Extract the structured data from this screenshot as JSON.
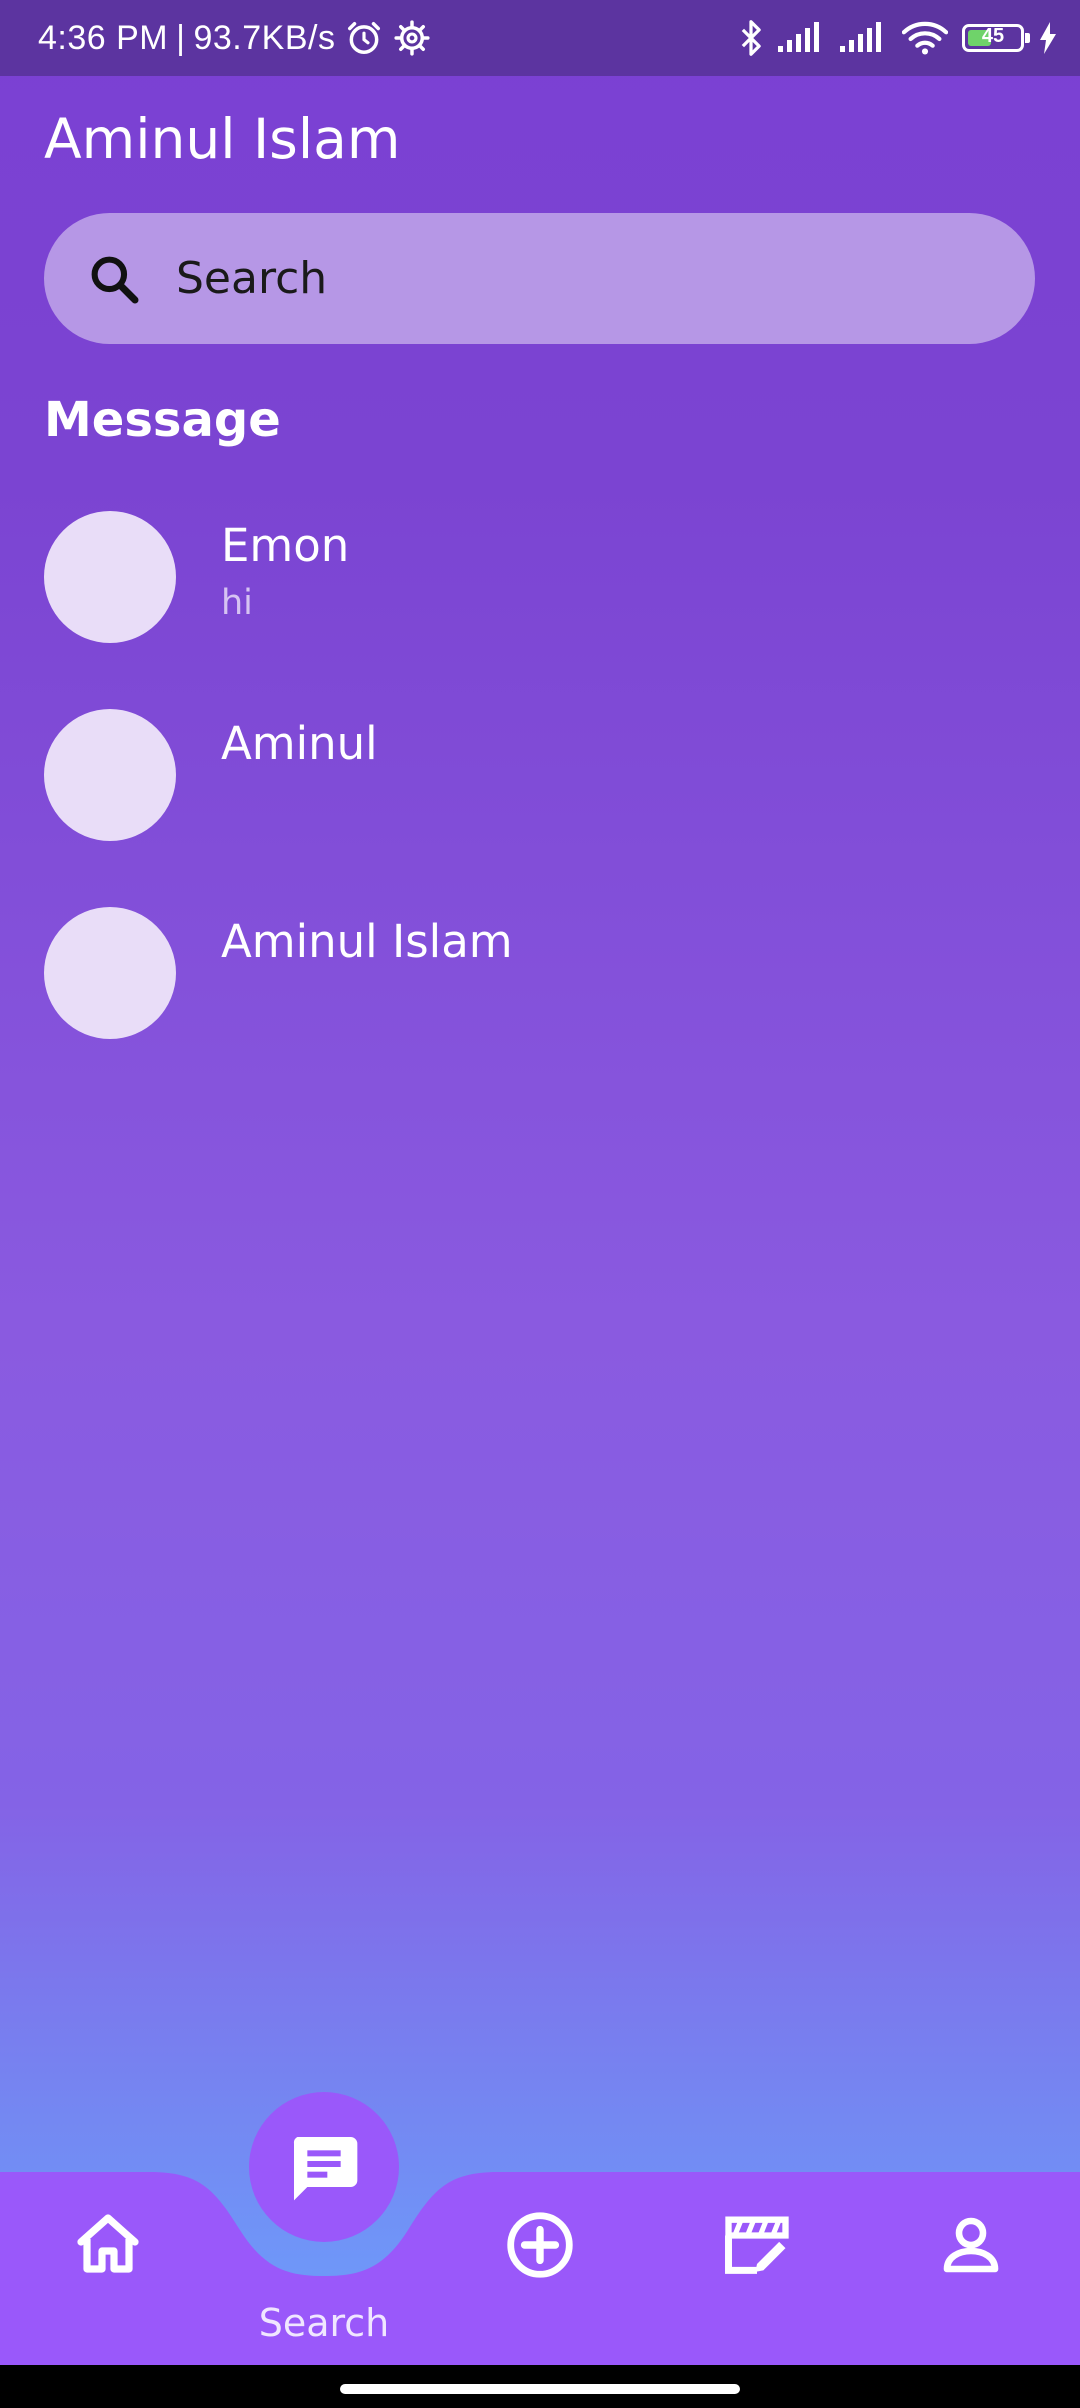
{
  "status_bar": {
    "time": "4:36 PM",
    "separator": "|",
    "net_speed": "93.7KB/s",
    "battery_level": "45",
    "battery_fraction": 0.45
  },
  "header": {
    "user_name": "Aminul Islam"
  },
  "search": {
    "placeholder": "Search"
  },
  "section": {
    "title": "Message"
  },
  "chats": [
    {
      "name": "Emon",
      "preview": "hi"
    },
    {
      "name": "Aminul",
      "preview": ""
    },
    {
      "name": "Aminul Islam",
      "preview": ""
    }
  ],
  "bottom_nav": {
    "items": [
      {
        "icon": "home-icon"
      },
      {
        "icon": "chat-icon",
        "label": "Search",
        "active": true
      },
      {
        "icon": "add-circle-icon"
      },
      {
        "icon": "video-edit-icon"
      },
      {
        "icon": "profile-icon"
      }
    ]
  },
  "colors": {
    "status_bar": "#5c34a0",
    "background_top": "#7b40d3",
    "background_bottom": "#6aa4fe",
    "search_bar": "#b697e6",
    "avatar": "#e9ddf8",
    "nav_bar": "#9a58fa"
  }
}
